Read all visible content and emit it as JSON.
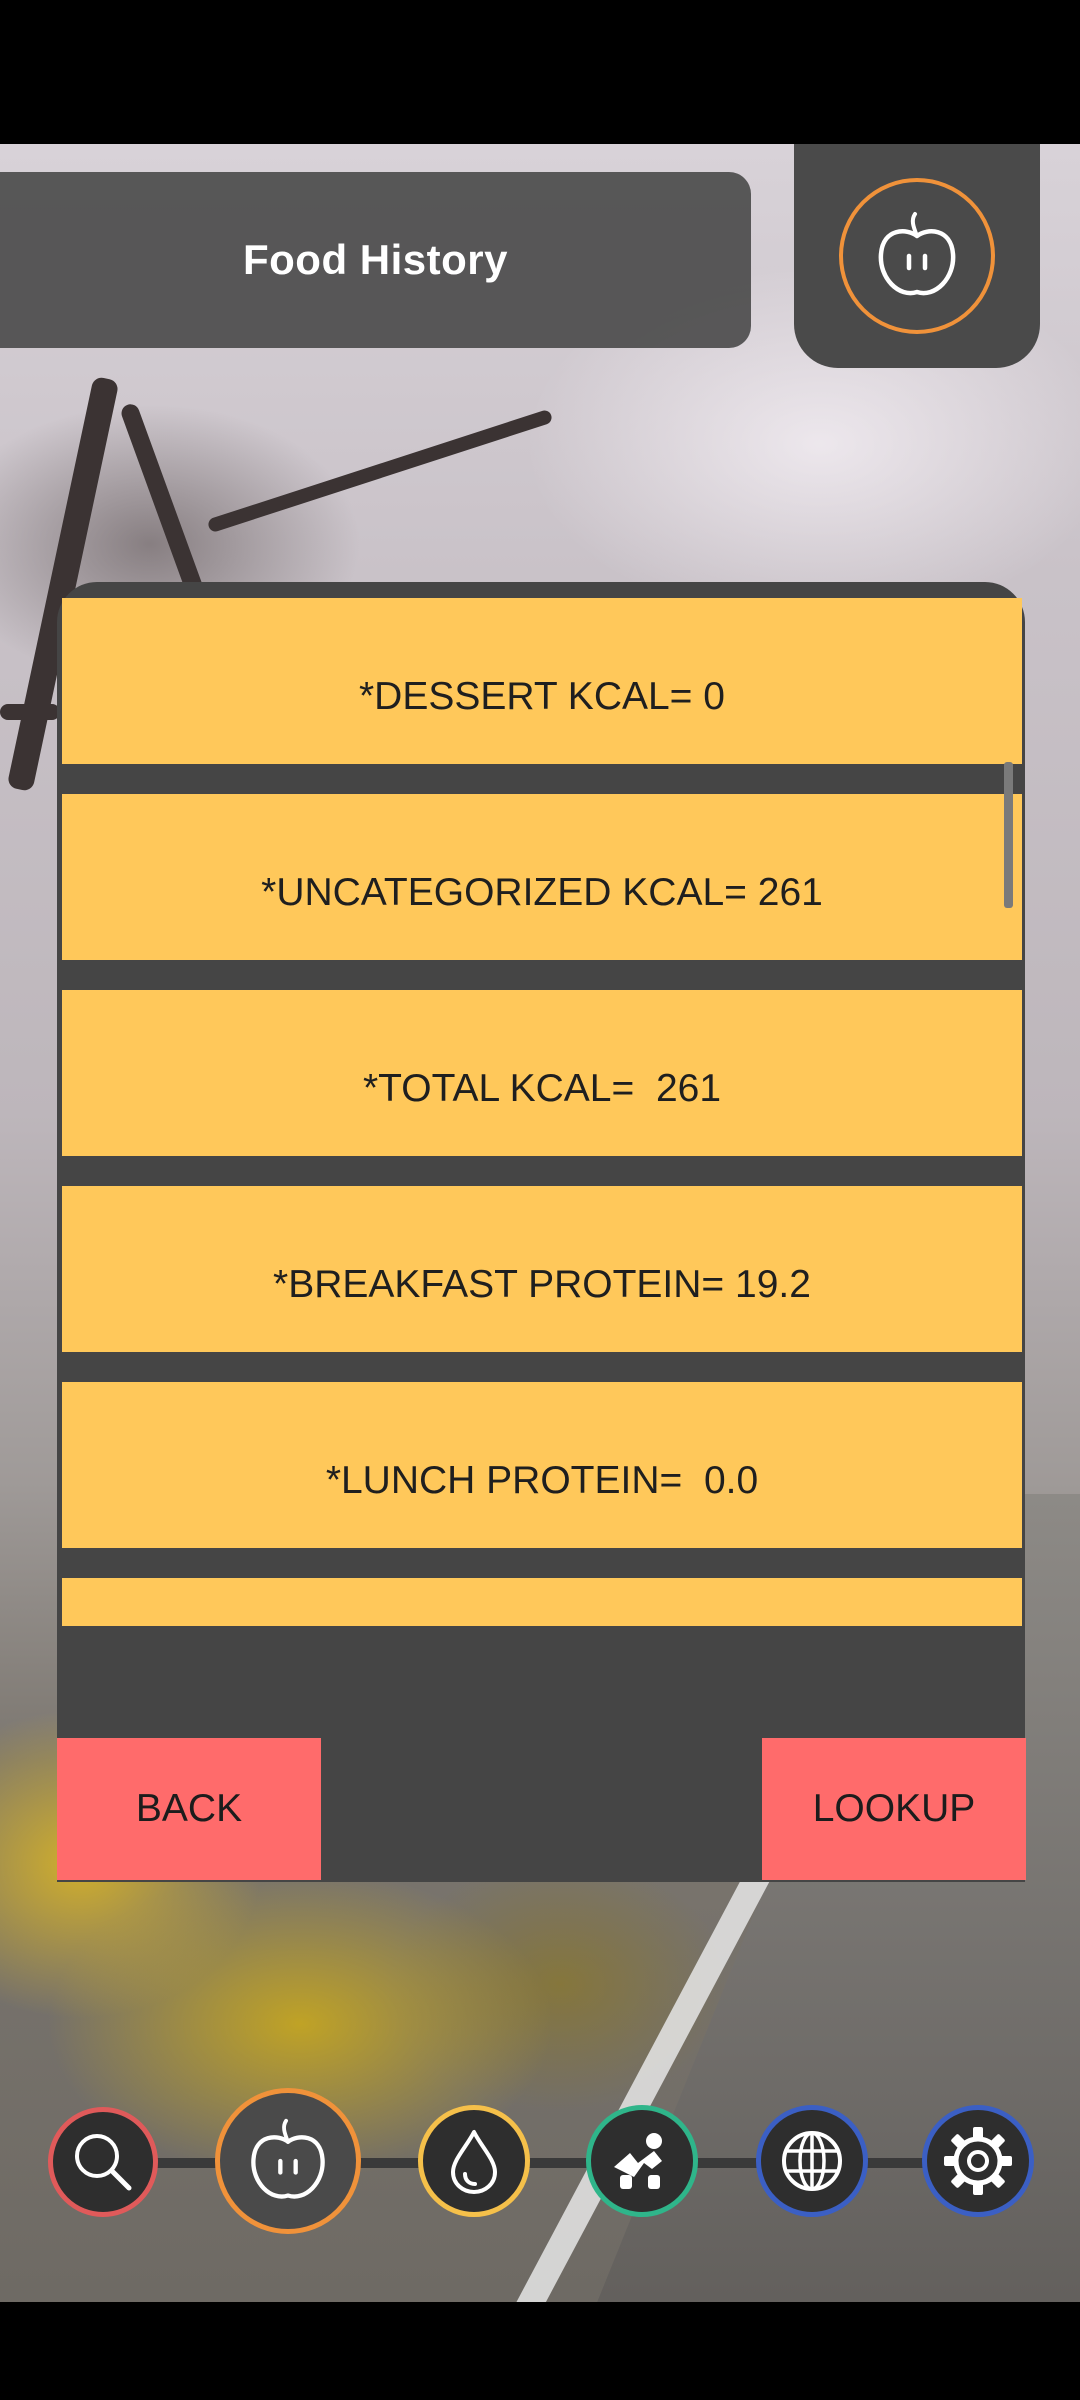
{
  "header": {
    "title": "Food History"
  },
  "list": {
    "rows": [
      {
        "label": "*DESSERT KCAL= 0"
      },
      {
        "label": "*UNCATEGORIZED KCAL= 261"
      },
      {
        "label": "*TOTAL KCAL=  261"
      },
      {
        "label": "*BREAKFAST PROTEIN= 19.2"
      },
      {
        "label": "*LUNCH PROTEIN=  0.0"
      }
    ]
  },
  "buttons": {
    "back": "BACK",
    "lookup": "LOOKUP"
  },
  "nav": {
    "items": [
      {
        "icon": "search-icon",
        "color": "#e05a5a"
      },
      {
        "icon": "apple-icon",
        "color": "#f0923a"
      },
      {
        "icon": "water-drop-icon",
        "color": "#f5c04a"
      },
      {
        "icon": "workout-icon",
        "color": "#2fb58a"
      },
      {
        "icon": "globe-icon",
        "color": "#3b5fc4"
      },
      {
        "icon": "gear-icon",
        "color": "#3b5fc4"
      }
    ]
  },
  "colors": {
    "row_background": "#ffc85a",
    "button_background": "#ff6b6b",
    "panel_background": "#454545",
    "accent_orange": "#f0923a"
  }
}
